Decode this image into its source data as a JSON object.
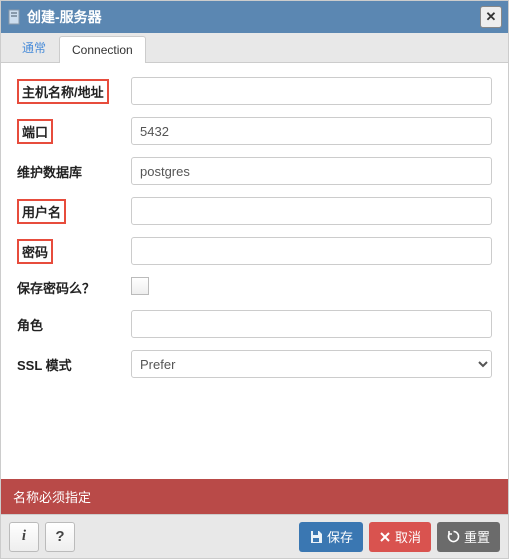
{
  "dialog": {
    "title": "创建-服务器"
  },
  "tabs": {
    "general": "通常",
    "connection": "Connection"
  },
  "form": {
    "host_label": "主机名称/地址",
    "host_value": "",
    "port_label": "端口",
    "port_value": "5432",
    "maintdb_label": "维护数据库",
    "maintdb_value": "postgres",
    "username_label": "用户名",
    "username_value": "",
    "password_label": "密码",
    "password_value": "",
    "savepwd_label": "保存密码么？",
    "role_label": "角色",
    "role_value": "",
    "sslmode_label": "SSL 模式",
    "sslmode_value": "Prefer"
  },
  "error": {
    "message": "名称必须指定"
  },
  "footer": {
    "info": "i",
    "help": "?",
    "save": "保存",
    "cancel": "取消",
    "reset": "重置"
  }
}
